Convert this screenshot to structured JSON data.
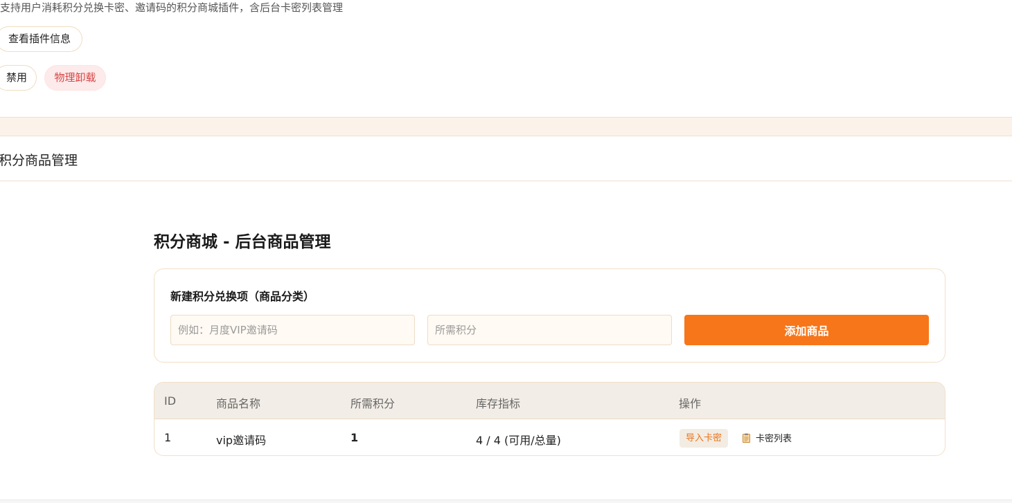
{
  "plugin": {
    "description": "支持用户消耗积分兑换卡密、邀请码的积分商城插件，含后台卡密列表管理",
    "info_button": "查看插件信息",
    "disable_button": "禁用",
    "uninstall_button": "物理卸载"
  },
  "section": {
    "title": "积分商品管理"
  },
  "admin": {
    "title": "积分商城 - 后台商品管理",
    "form": {
      "title": "新建积分兑换项（商品分类）",
      "name_placeholder": "例如：月度VIP邀请码",
      "points_placeholder": "所需积分",
      "add_button": "添加商品"
    },
    "table": {
      "headers": [
        "ID",
        "商品名称",
        "所需积分",
        "库存指标",
        "操作"
      ],
      "rows": [
        {
          "id": "1",
          "name": "vip邀请码",
          "points": "1",
          "stock": "4 / 4 (可用/总量)",
          "import_button": "导入卡密",
          "list_link": "卡密列表"
        }
      ]
    }
  },
  "icons": {
    "card_list": "clipboard-icon"
  },
  "colors": {
    "accent": "#f7761a",
    "danger": "#d64545"
  }
}
